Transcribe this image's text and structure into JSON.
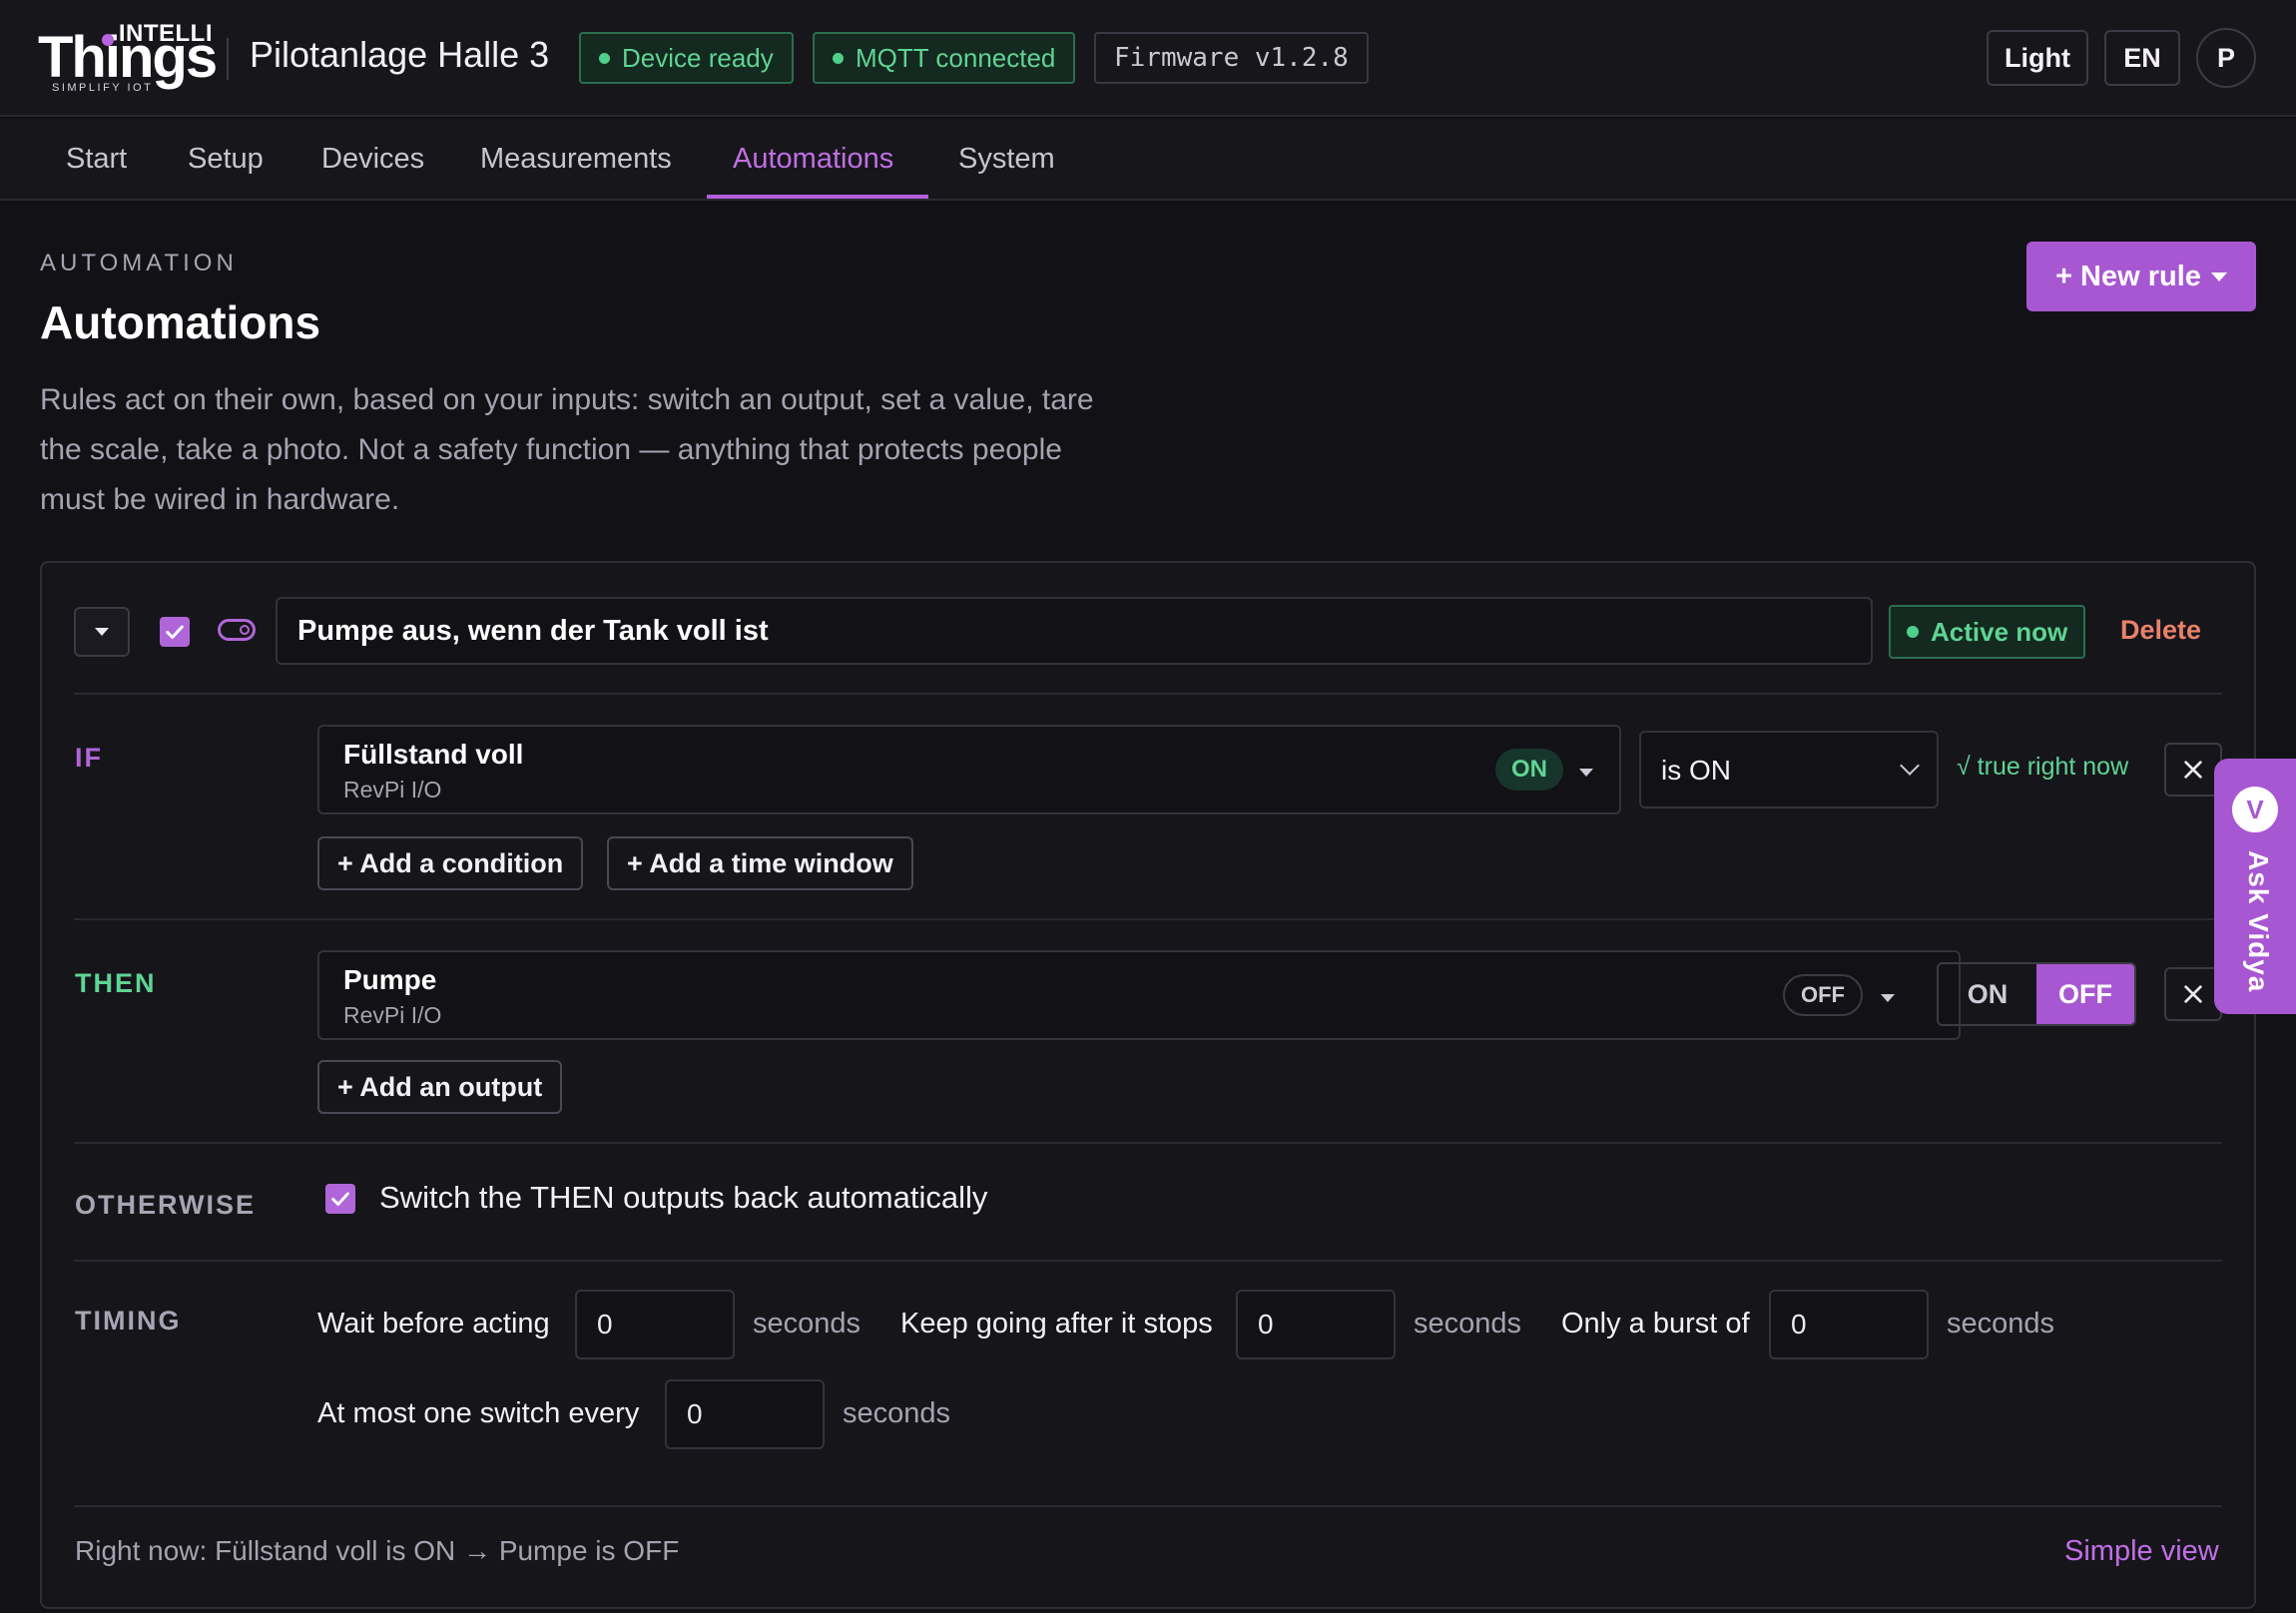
{
  "brand": {
    "logo_top": "INTELLI",
    "logo_main": "Things",
    "logo_tagline": "SIMPLIFY IOT",
    "site_title": "Pilotanlage Halle 3"
  },
  "status": {
    "device": "Device ready",
    "mqtt": "MQTT connected",
    "firmware": "Firmware v1.2.8"
  },
  "header_controls": {
    "theme": "Light",
    "language": "EN",
    "avatar": "P"
  },
  "tabs": [
    {
      "label": "Start"
    },
    {
      "label": "Setup"
    },
    {
      "label": "Devices"
    },
    {
      "label": "Measurements"
    },
    {
      "label": "Automations",
      "active": true
    },
    {
      "label": "System"
    }
  ],
  "page": {
    "eyebrow": "AUTOMATION",
    "title": "Automations",
    "description": "Rules act on their own, based on your inputs: switch an output, set a value, tare the scale, take a photo. Not a safety function — anything that protects people must be wired in hardware.",
    "new_rule": "+ New rule"
  },
  "rule": {
    "name": "Pumpe aus, wenn der Tank voll ist",
    "status": "Active now",
    "delete": "Delete",
    "if": {
      "label": "IF",
      "input_name": "Füllstand voll",
      "input_source": "RevPi I/O",
      "input_state": "ON",
      "operator": "is ON",
      "evaluation": "√ true right now",
      "add_condition": "+ Add a condition",
      "add_time_window": "+ Add a time window"
    },
    "then": {
      "label": "THEN",
      "output_name": "Pumpe",
      "output_source": "RevPi I/O",
      "output_state": "OFF",
      "set_on": "ON",
      "set_off": "OFF",
      "selected": "OFF",
      "add_output": "+ Add an output"
    },
    "otherwise": {
      "label": "OTHERWISE",
      "text": "Switch the THEN outputs back automatically",
      "checked": true
    },
    "timing": {
      "label": "TIMING",
      "wait_label": "Wait before acting",
      "wait_value": "0",
      "keep_label": "Keep going after it stops",
      "keep_value": "0",
      "burst_label": "Only a burst of",
      "burst_value": "0",
      "max_label": "At most one switch every",
      "max_value": "0",
      "unit": "seconds"
    },
    "summary": "Right now: Füllstand voll is ON → Pumpe is OFF",
    "simple_view": "Simple view"
  },
  "assistant": {
    "initial": "V",
    "label": "Ask Vidya"
  },
  "colors": {
    "accent": "#a857d2",
    "success": "#5fd494",
    "danger": "#e9826a",
    "background": "#121115"
  }
}
